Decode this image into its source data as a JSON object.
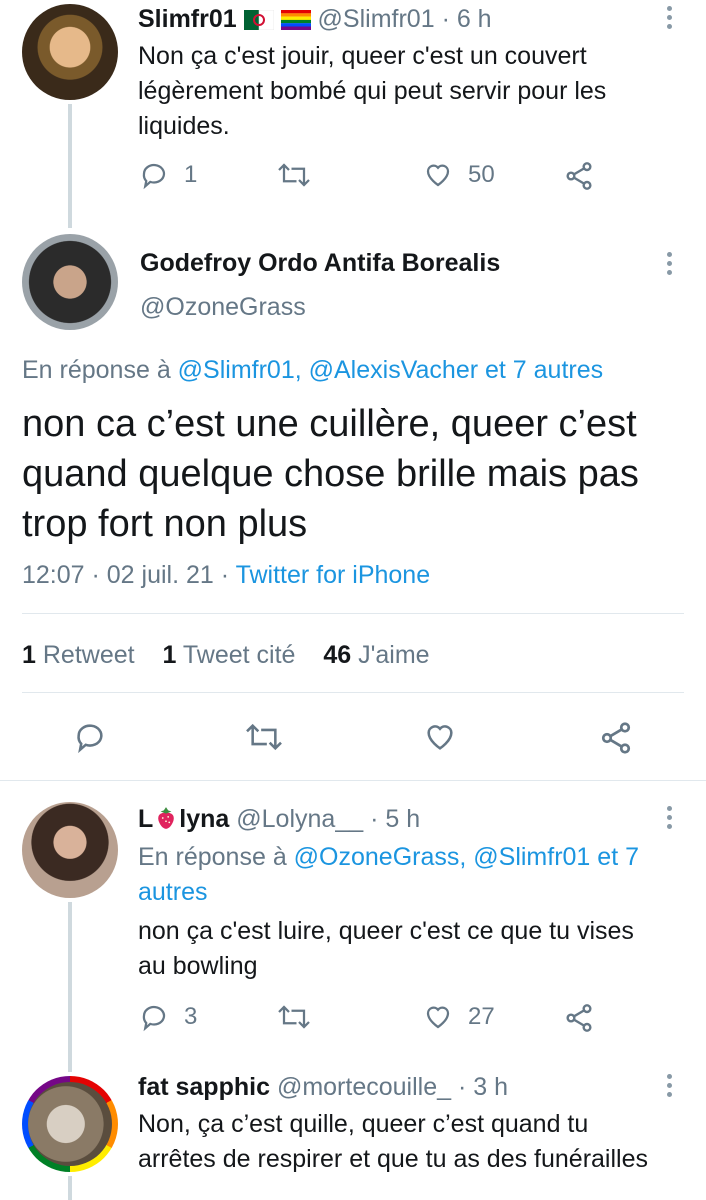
{
  "tweet1": {
    "display_name": "Slimfr01",
    "handle": "@Slimfr01",
    "time": "· 6 h",
    "text_lines": [
      "Non ça c'est jouir, queer c'est un couvert",
      "légèrement bombé qui peut servir pour les",
      "liquides."
    ],
    "reply_count": "1",
    "like_count": "50"
  },
  "main": {
    "display_name": "Godefroy Ordo Antifa Borealis",
    "handle": "@OzoneGrass",
    "reply_prefix": "En réponse à",
    "reply_targets": "@Slimfr01, @AlexisVacher et 7 autres",
    "text_lines": [
      "non ca c’est une cuillère, queer c’est",
      "quand quelque chose brille mais pas",
      "trop fort non plus"
    ],
    "timestamp": "12:07 · 02 juil. 21 ·",
    "client": "Twitter for iPhone",
    "stats": {
      "retweets_count": "1",
      "retweets_label": "Retweet",
      "quotes_count": "1",
      "quotes_label": "Tweet cité",
      "likes_count": "46",
      "likes_label": "J'aime"
    }
  },
  "reply1": {
    "display_name_a": "L",
    "display_name_b": "lyna",
    "handle": "@Lolyna__",
    "time": "· 5 h",
    "reply_prefix": "En réponse à",
    "reply_targets_line1": "@OzoneGrass, @Slimfr01 et 7",
    "reply_targets_line2": "autres",
    "text_lines": [
      "non ça c'est luire, queer c'est ce que tu vises",
      "au bowling"
    ],
    "reply_count": "3",
    "like_count": "27"
  },
  "reply2": {
    "display_name": "fat sapphic",
    "handle": "@mortecouille_",
    "time": "· 3 h",
    "text_lines": [
      "Non, ça c’est quille, queer c’est quand tu",
      "arrêtes de respirer et que tu as des funérailles"
    ]
  },
  "colors": {
    "accent": "#1b95e0",
    "muted": "#657786",
    "line": "#cfd9de"
  },
  "icons": [
    "reply-icon",
    "retweet-icon",
    "like-icon",
    "share-icon",
    "more-icon",
    "strawberry-icon",
    "algeria-flag-icon",
    "rainbow-flag-icon"
  ]
}
